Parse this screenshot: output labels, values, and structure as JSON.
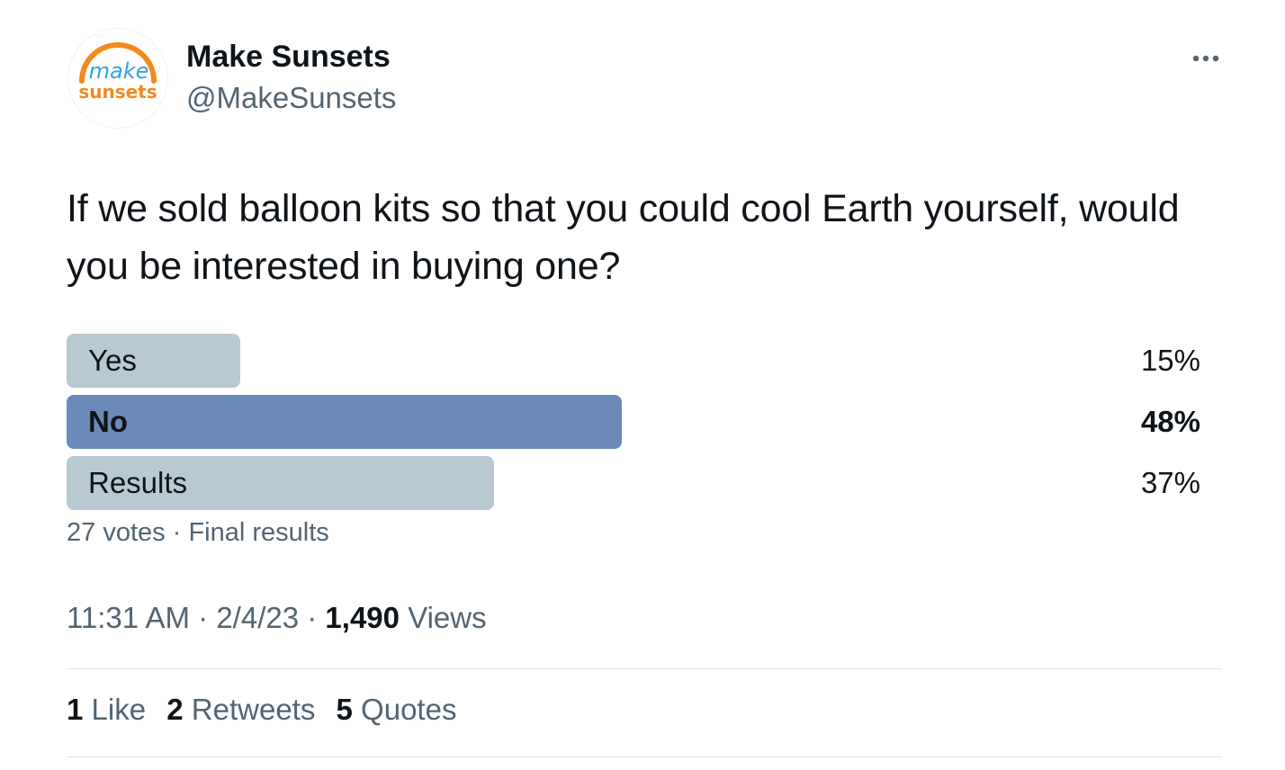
{
  "author": {
    "display_name": "Make Sunsets",
    "handle": "@MakeSunsets",
    "avatar_line1": "make",
    "avatar_line2": "sunsets",
    "avatar_colors": {
      "arc": "#f28a1c",
      "make": "#2aa6df",
      "sunsets": "#f28a1c"
    }
  },
  "more_icon": "ellipsis-icon",
  "tweet_text": "If we sold balloon kits so that you could cool Earth yourself, would you be interested in buying one?",
  "poll": {
    "options": [
      {
        "label": "Yes",
        "percent_text": "15%",
        "percent": 15,
        "winner": false
      },
      {
        "label": "No",
        "percent_text": "48%",
        "percent": 48,
        "winner": true
      },
      {
        "label": "Results",
        "percent_text": "37%",
        "percent": 37,
        "winner": false
      }
    ],
    "votes": "27 votes",
    "sep": "·",
    "status": "Final results",
    "colors": {
      "bar": "#b9c9d2",
      "winner_bar": "#6a8bb9"
    }
  },
  "meta": {
    "time": "11:31 AM",
    "sep": "·",
    "date": "2/4/23",
    "views_count": "1,490",
    "views_label": "Views"
  },
  "stats": {
    "likes_count": "1",
    "likes_label": "Like",
    "retweets_count": "2",
    "retweets_label": "Retweets",
    "quotes_count": "5",
    "quotes_label": "Quotes"
  }
}
